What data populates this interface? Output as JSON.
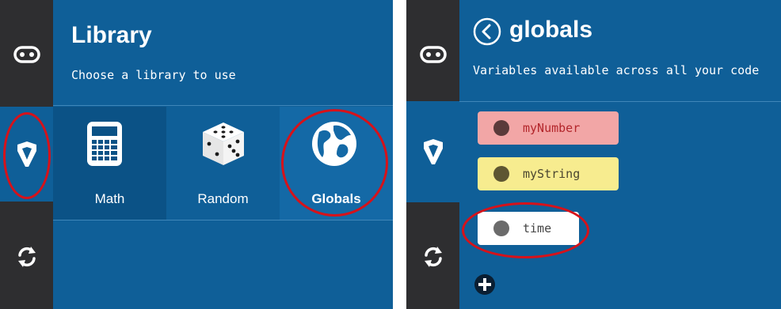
{
  "library": {
    "title": "Library",
    "subtitle": "Choose a library to use",
    "items": [
      {
        "label": "Math",
        "icon": "calculator-icon"
      },
      {
        "label": "Random",
        "icon": "dice-icon"
      },
      {
        "label": "Globals",
        "icon": "globe-icon"
      }
    ]
  },
  "globals": {
    "title": "globals",
    "subtitle": "Variables available across all your code",
    "variables": [
      {
        "label": "myNumber",
        "bg": "#f2a6a6",
        "dot": "#5b3a3a",
        "text": "#b3262b"
      },
      {
        "label": "myString",
        "bg": "#f7ec8f",
        "dot": "#5e5632",
        "text": "#4b4630"
      },
      {
        "label": "time",
        "bg": "#ffffff",
        "dot": "#6b6b6b",
        "text": "#444444"
      }
    ]
  },
  "sidebar": {
    "items": [
      {
        "icon": "device-icon"
      },
      {
        "icon": "library-icon"
      },
      {
        "icon": "sync-icon"
      }
    ]
  },
  "colors": {
    "panel": "#0f5f98",
    "rail": "#2e2e30",
    "highlight": "#d6121a",
    "selected_tile": "#0b5286",
    "hover_tile": "#1469a6"
  }
}
